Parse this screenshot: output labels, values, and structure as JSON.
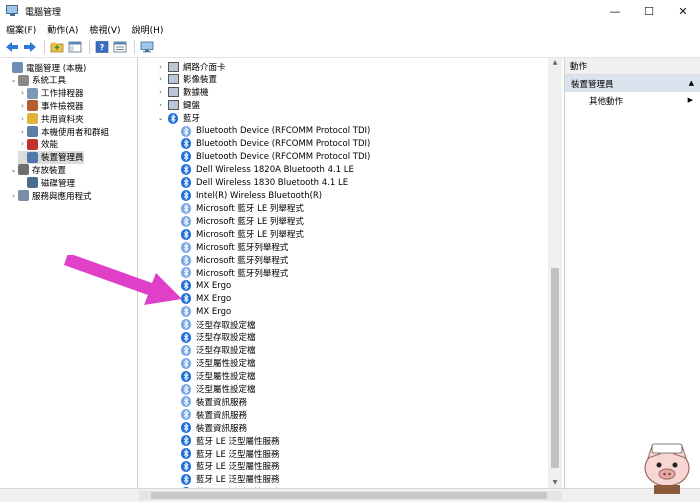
{
  "window": {
    "title": "電腦管理",
    "controls": {
      "minimize": "—",
      "maximize": "☐",
      "close": "✕"
    }
  },
  "menu": {
    "items": [
      "檔案(F)",
      "動作(A)",
      "檢視(V)",
      "說明(H)"
    ]
  },
  "toolbar": {
    "icons": [
      "back-icon",
      "forward-icon",
      "folder-up-icon",
      "show-hide-tree-icon",
      "help-icon",
      "properties-icon",
      "computer-icon"
    ]
  },
  "tree": {
    "items": [
      {
        "label": "電腦管理 (本機)",
        "expander": "",
        "icon_color": "#6b8fb5"
      },
      {
        "label": "系統工具",
        "expander": "v",
        "icon_color": "#8a8a8a"
      },
      {
        "label": "工作排程器",
        "expander": ">",
        "icon_color": "#7c9ab8"
      },
      {
        "label": "事件檢視器",
        "expander": ">",
        "icon_color": "#b45b2f"
      },
      {
        "label": "共用資料夾",
        "expander": ">",
        "icon_color": "#e0b43a"
      },
      {
        "label": "本機使用者和群組",
        "expander": ">",
        "icon_color": "#5b7fa6"
      },
      {
        "label": "效能",
        "expander": ">",
        "icon_color": "#c03030"
      },
      {
        "label": "裝置管理員",
        "expander": "",
        "icon_color": "#4f79a8"
      },
      {
        "label": "存放裝置",
        "expander": "v",
        "icon_color": "#6f6f6f"
      },
      {
        "label": "磁碟管理",
        "expander": "",
        "icon_color": "#4a6f8e"
      },
      {
        "label": "服務與應用程式",
        "expander": ">",
        "icon_color": "#7a8fa6"
      }
    ]
  },
  "devices": {
    "categories": [
      {
        "label": "網路介面卡",
        "expander": ">"
      },
      {
        "label": "影像裝置",
        "expander": ">"
      },
      {
        "label": "數據機",
        "expander": ">"
      },
      {
        "label": "鍵盤",
        "expander": ">"
      },
      {
        "label": "藍牙",
        "expander": "v"
      }
    ],
    "bluetooth_items": [
      {
        "label": "Bluetooth Device (RFCOMM Protocol TDI)",
        "dim": true
      },
      {
        "label": "Bluetooth Device (RFCOMM Protocol TDI)",
        "dim": false
      },
      {
        "label": "Bluetooth Device (RFCOMM Protocol TDI)",
        "dim": false
      },
      {
        "label": "Dell Wireless 1820A Bluetooth 4.1 LE",
        "dim": false
      },
      {
        "label": "Dell Wireless 1830 Bluetooth 4.1 LE",
        "dim": false
      },
      {
        "label": "Intel(R) Wireless Bluetooth(R)",
        "dim": false
      },
      {
        "label": "Microsoft 藍牙 LE 列舉程式",
        "dim": true
      },
      {
        "label": "Microsoft 藍牙 LE 列舉程式",
        "dim": true
      },
      {
        "label": "Microsoft 藍牙 LE 列舉程式",
        "dim": false
      },
      {
        "label": "Microsoft 藍牙列舉程式",
        "dim": true
      },
      {
        "label": "Microsoft 藍牙列舉程式",
        "dim": true
      },
      {
        "label": "Microsoft 藍牙列舉程式",
        "dim": true
      },
      {
        "label": "MX Ergo",
        "dim": false
      },
      {
        "label": "MX Ergo",
        "dim": false
      },
      {
        "label": "MX Ergo",
        "dim": true
      },
      {
        "label": "泛型存取設定檔",
        "dim": true
      },
      {
        "label": "泛型存取設定檔",
        "dim": false
      },
      {
        "label": "泛型存取設定檔",
        "dim": true
      },
      {
        "label": "泛型屬性設定檔",
        "dim": true
      },
      {
        "label": "泛型屬性設定檔",
        "dim": false
      },
      {
        "label": "泛型屬性設定檔",
        "dim": true
      },
      {
        "label": "裝置資訊服務",
        "dim": true
      },
      {
        "label": "裝置資訊服務",
        "dim": true
      },
      {
        "label": "裝置資訊服務",
        "dim": false
      },
      {
        "label": "藍牙 LE 泛型屬性服務",
        "dim": false
      },
      {
        "label": "藍牙 LE 泛型屬性服務",
        "dim": false
      },
      {
        "label": "藍牙 LE 泛型屬性服務",
        "dim": false
      },
      {
        "label": "藍牙 LE 泛型屬性服務",
        "dim": false
      },
      {
        "label": "藍牙 LE 泛型屬性服務",
        "dim": false
      }
    ]
  },
  "actions": {
    "header": "動作",
    "section": "裝置管理員",
    "section_caret": "▲",
    "items": [
      {
        "label": "其他動作",
        "caret": "▶"
      }
    ]
  },
  "colors": {
    "bluetooth": "#1e6fd9",
    "bluetooth_dim": "#78a7e6",
    "annotation_arrow": "#e040c8",
    "selected_row": "#dcdcdc"
  }
}
